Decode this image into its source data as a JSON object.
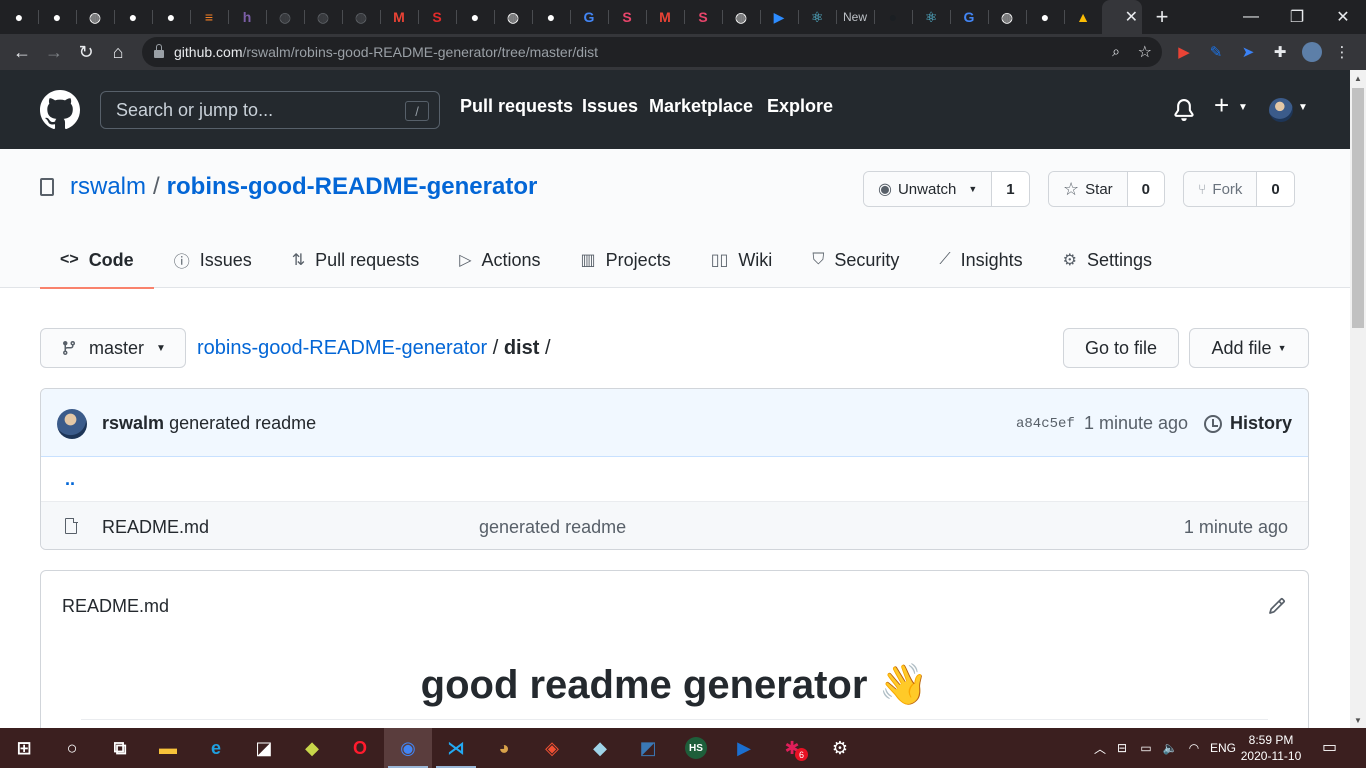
{
  "browser": {
    "tabs": [
      {
        "icon": "github-icon",
        "color": "#ffffff"
      },
      {
        "icon": "github-icon",
        "color": "#ffffff"
      },
      {
        "icon": "globe-icon",
        "color": "#ffffff"
      },
      {
        "icon": "github-icon",
        "color": "#ffffff"
      },
      {
        "icon": "github-icon",
        "color": "#ffffff"
      },
      {
        "icon": "stackoverflow-icon",
        "color": "#f48024"
      },
      {
        "icon": "h-icon",
        "color": "#7b5ea7"
      },
      {
        "icon": "globe-icon",
        "color": "#5f6368"
      },
      {
        "icon": "globe-icon",
        "color": "#5f6368"
      },
      {
        "icon": "globe-icon",
        "color": "#5f6368"
      },
      {
        "icon": "gmail-icon",
        "color": "#ea4335"
      },
      {
        "icon": "s-icon",
        "color": "#e02b2b"
      },
      {
        "icon": "github-icon",
        "color": "#ffffff"
      },
      {
        "icon": "globe-icon",
        "color": "#ffffff"
      },
      {
        "icon": "github-icon",
        "color": "#ffffff"
      },
      {
        "icon": "google-icon",
        "color": "#4285f4"
      },
      {
        "icon": "s-icon",
        "color": "#e8456b"
      },
      {
        "icon": "gmail-icon",
        "color": "#ea4335"
      },
      {
        "icon": "s-icon",
        "color": "#e8456b"
      },
      {
        "icon": "globe-icon",
        "color": "#ffffff"
      },
      {
        "icon": "zoom-icon",
        "color": "#2d8cff"
      },
      {
        "icon": "react-icon",
        "color": "#61dafb"
      },
      {
        "icon": "text",
        "label": "New",
        "color": "#bdc1c6"
      },
      {
        "icon": "github-icon",
        "color": "#1b1f23"
      },
      {
        "icon": "react-icon",
        "color": "#61dafb"
      },
      {
        "icon": "google-icon",
        "color": "#4285f4"
      },
      {
        "icon": "globe-icon",
        "color": "#ffffff"
      },
      {
        "icon": "github-icon",
        "color": "#ffffff"
      },
      {
        "icon": "drive-icon",
        "color": "#fbbc04"
      }
    ],
    "url_host": "github.com",
    "url_path": "/rswalm/robins-good-README-generator/tree/master/dist"
  },
  "github": {
    "search_placeholder": "Search or jump to...",
    "search_key": "/",
    "nav": [
      "Pull requests",
      "Issues",
      "Marketplace",
      "Explore"
    ]
  },
  "repo": {
    "owner": "rswalm",
    "separator": "/",
    "name": "robins-good-README-generator",
    "watch_label": "Unwatch",
    "watch_count": "1",
    "star_label": "Star",
    "star_count": "0",
    "fork_label": "Fork",
    "fork_count": "0",
    "tabs": [
      {
        "label": "Code",
        "icon": "code-icon",
        "active": true
      },
      {
        "label": "Issues",
        "icon": "issue-icon",
        "active": false
      },
      {
        "label": "Pull requests",
        "icon": "pull-request-icon",
        "active": false
      },
      {
        "label": "Actions",
        "icon": "play-icon",
        "active": false
      },
      {
        "label": "Projects",
        "icon": "project-icon",
        "active": false
      },
      {
        "label": "Wiki",
        "icon": "book-icon",
        "active": false
      },
      {
        "label": "Security",
        "icon": "shield-icon",
        "active": false
      },
      {
        "label": "Insights",
        "icon": "graph-icon",
        "active": false
      },
      {
        "label": "Settings",
        "icon": "gear-icon",
        "active": false
      }
    ]
  },
  "browser_view": {
    "branch": "master",
    "crumb_repo": "robins-good-README-generator",
    "crumb_sep1": "/",
    "crumb_dir": "dist",
    "crumb_sep2": "/",
    "go_to_file": "Go to file",
    "add_file": "Add file"
  },
  "commit": {
    "author": "rswalm",
    "message": "generated readme",
    "sha": "a84c5ef",
    "age": "1 minute ago",
    "history_label": "History"
  },
  "files": {
    "parent_link": "..",
    "items": [
      {
        "name": "README.md",
        "message": "generated readme",
        "age": "1 minute ago"
      }
    ]
  },
  "readme": {
    "filename": "README.md",
    "heading": "good readme generator",
    "emoji": "👋"
  },
  "taskbar": {
    "apps": [
      {
        "icon": "windows-start-icon",
        "color": "#ffffff"
      },
      {
        "icon": "cortana-search-icon",
        "color": "#ffffff"
      },
      {
        "icon": "task-view-icon",
        "color": "#ffffff"
      },
      {
        "icon": "file-explorer-icon",
        "color": "#f8c33a"
      },
      {
        "icon": "edge-icon",
        "color": "#1fa0e0"
      },
      {
        "icon": "sticky-notes-icon",
        "color": "#ffffff"
      },
      {
        "icon": "app-icon",
        "color": "#c8d64a"
      },
      {
        "icon": "opera-icon",
        "color": "#ff1b2d"
      },
      {
        "icon": "chrome-icon",
        "color": "#4285f4"
      },
      {
        "icon": "vscode-icon",
        "color": "#23a9f2"
      },
      {
        "icon": "paint-icon",
        "color": "#d9a24a"
      },
      {
        "icon": "git-icon",
        "color": "#f05033"
      },
      {
        "icon": "app-icon",
        "color": "#9fd4e8"
      },
      {
        "icon": "mysql-workbench-icon",
        "color": "#3a78b5"
      },
      {
        "icon": "hs-icon",
        "color": "#1e5e3a"
      },
      {
        "icon": "media-player-icon",
        "color": "#1b6fd0"
      },
      {
        "icon": "slack-icon",
        "color": "#e01e5a"
      },
      {
        "icon": "settings-icon",
        "color": "#ffffff"
      }
    ],
    "slack_badge": "6",
    "language": "ENG",
    "time": "8:59 PM",
    "date": "2020-11-10"
  }
}
